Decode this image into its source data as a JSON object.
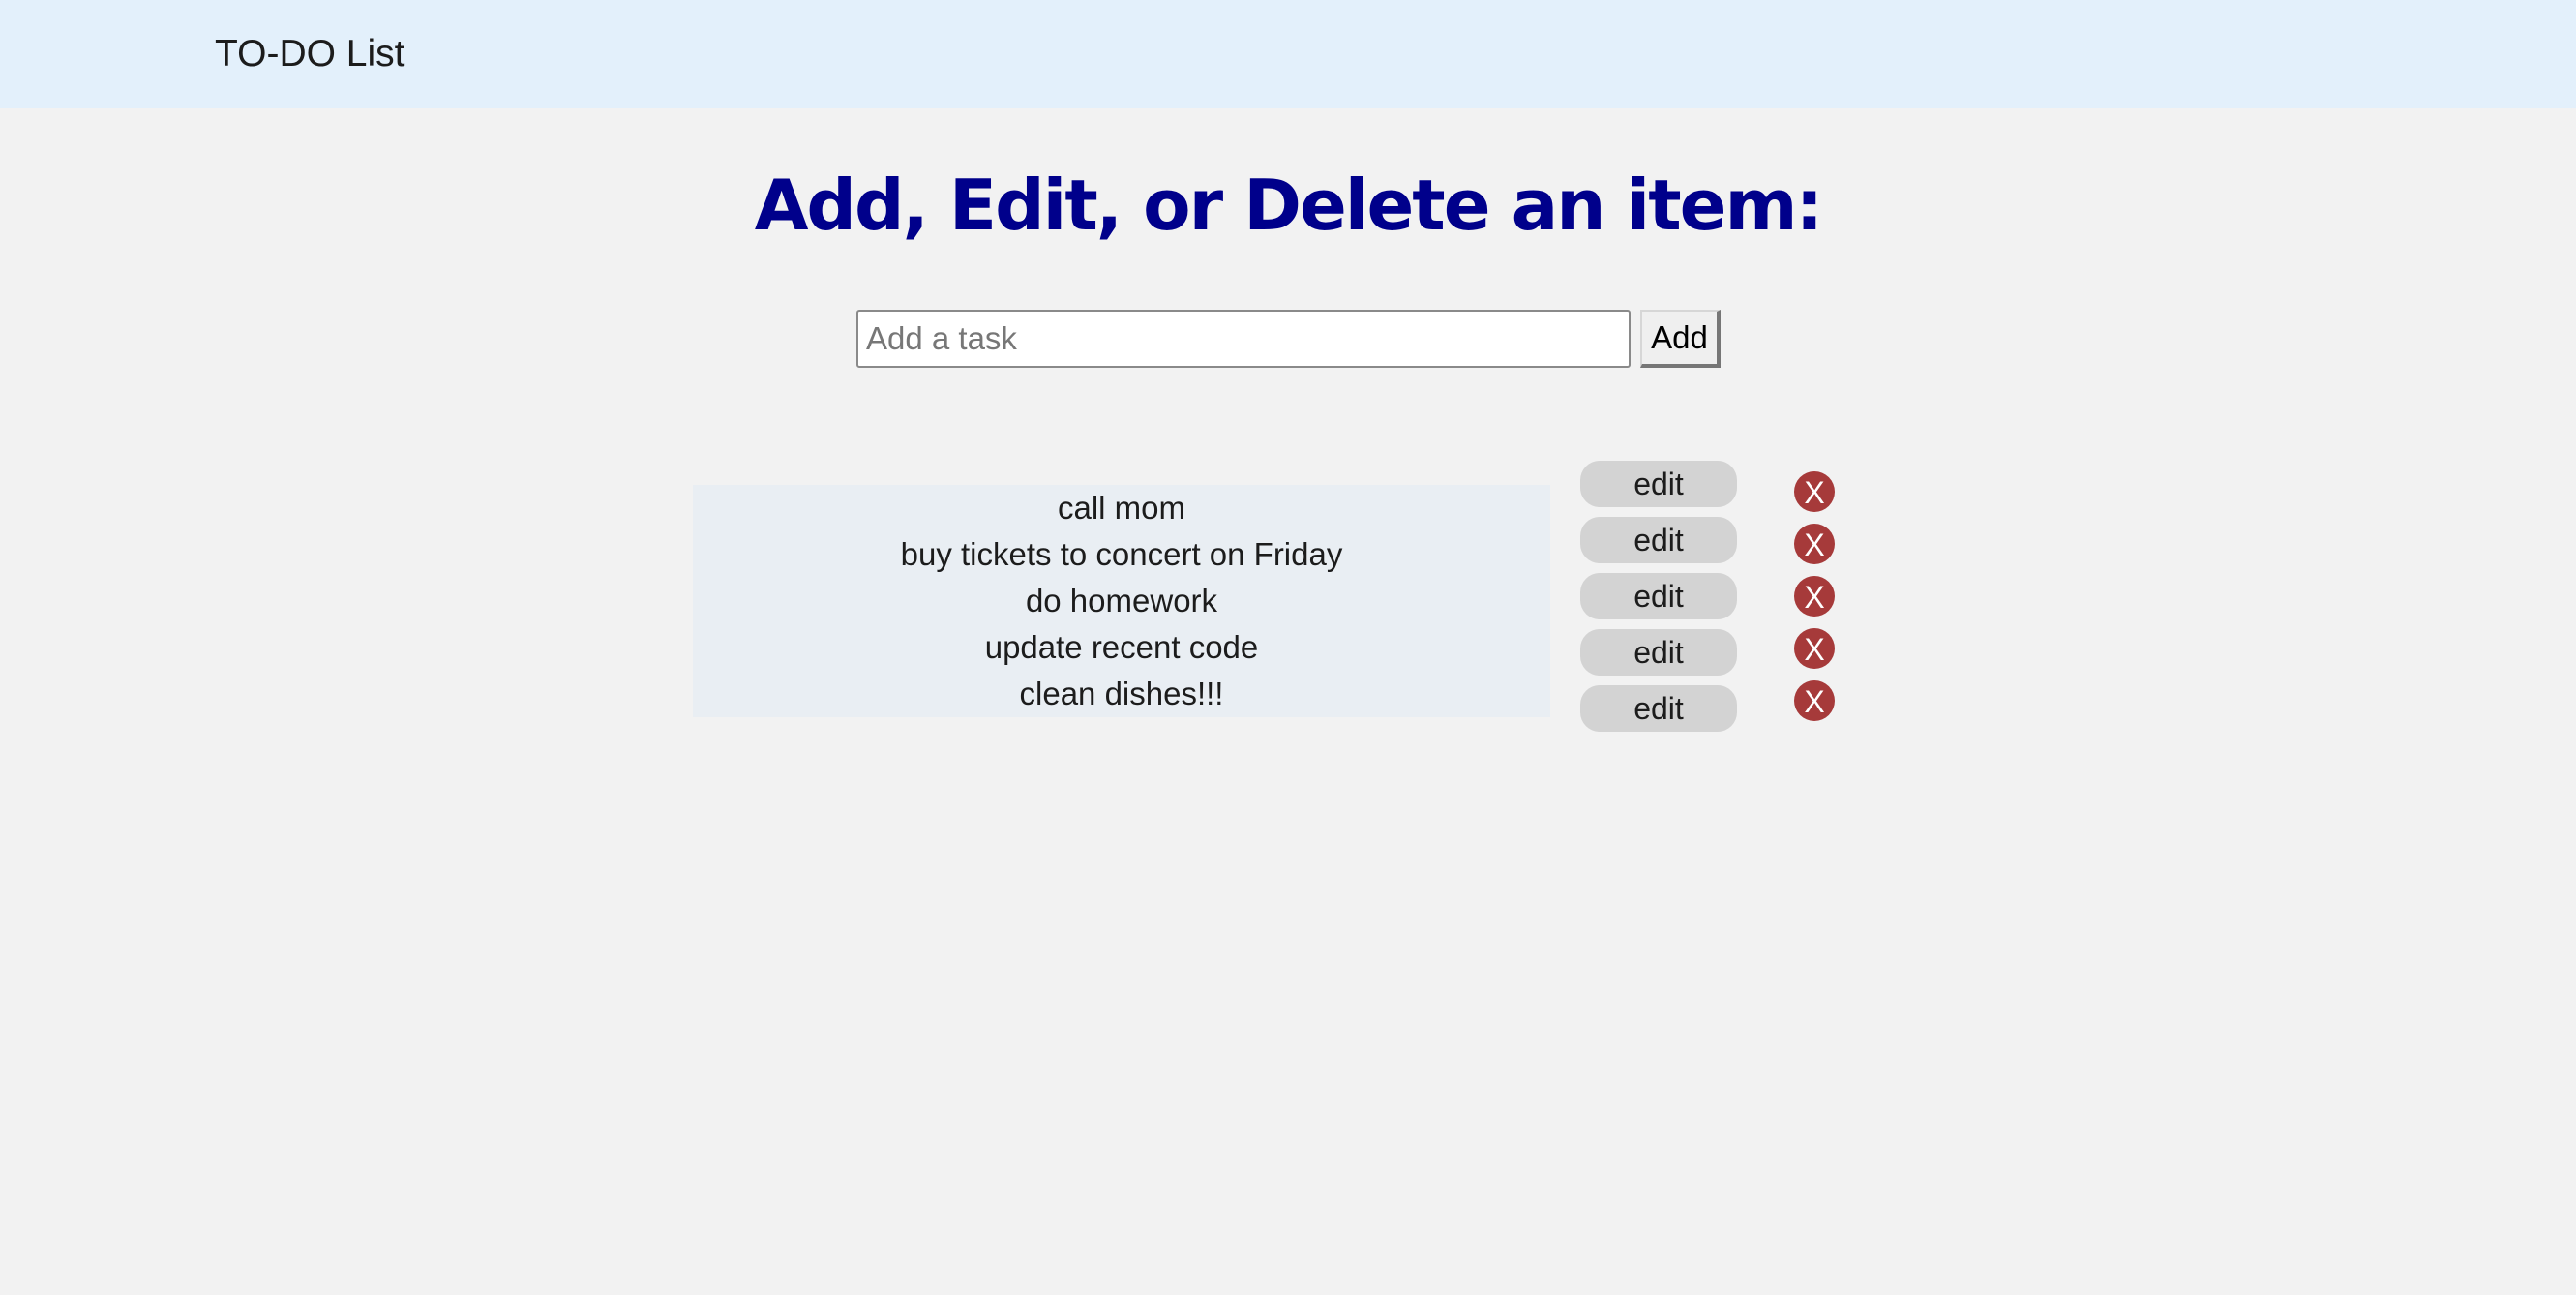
{
  "navbar": {
    "brand": "TO-DO List",
    "background": "#e3f0fb"
  },
  "main": {
    "title": "Add, Edit, or Delete an item:",
    "title_color": "#00008b",
    "input": {
      "placeholder": "Add a task",
      "value": ""
    },
    "add_label": "Add",
    "tasks": [
      {
        "text": "call mom",
        "edit_label": "edit",
        "delete_label": "X"
      },
      {
        "text": "buy tickets to concert on Friday",
        "edit_label": "edit",
        "delete_label": "X"
      },
      {
        "text": "do homework",
        "edit_label": "edit",
        "delete_label": "X"
      },
      {
        "text": "update recent code",
        "edit_label": "edit",
        "delete_label": "X"
      },
      {
        "text": "clean dishes!!!",
        "edit_label": "edit",
        "delete_label": "X"
      }
    ]
  },
  "colors": {
    "delete": "#a63a3a",
    "edit": "#d3d3d3",
    "list_bg": "#e9eef3"
  }
}
